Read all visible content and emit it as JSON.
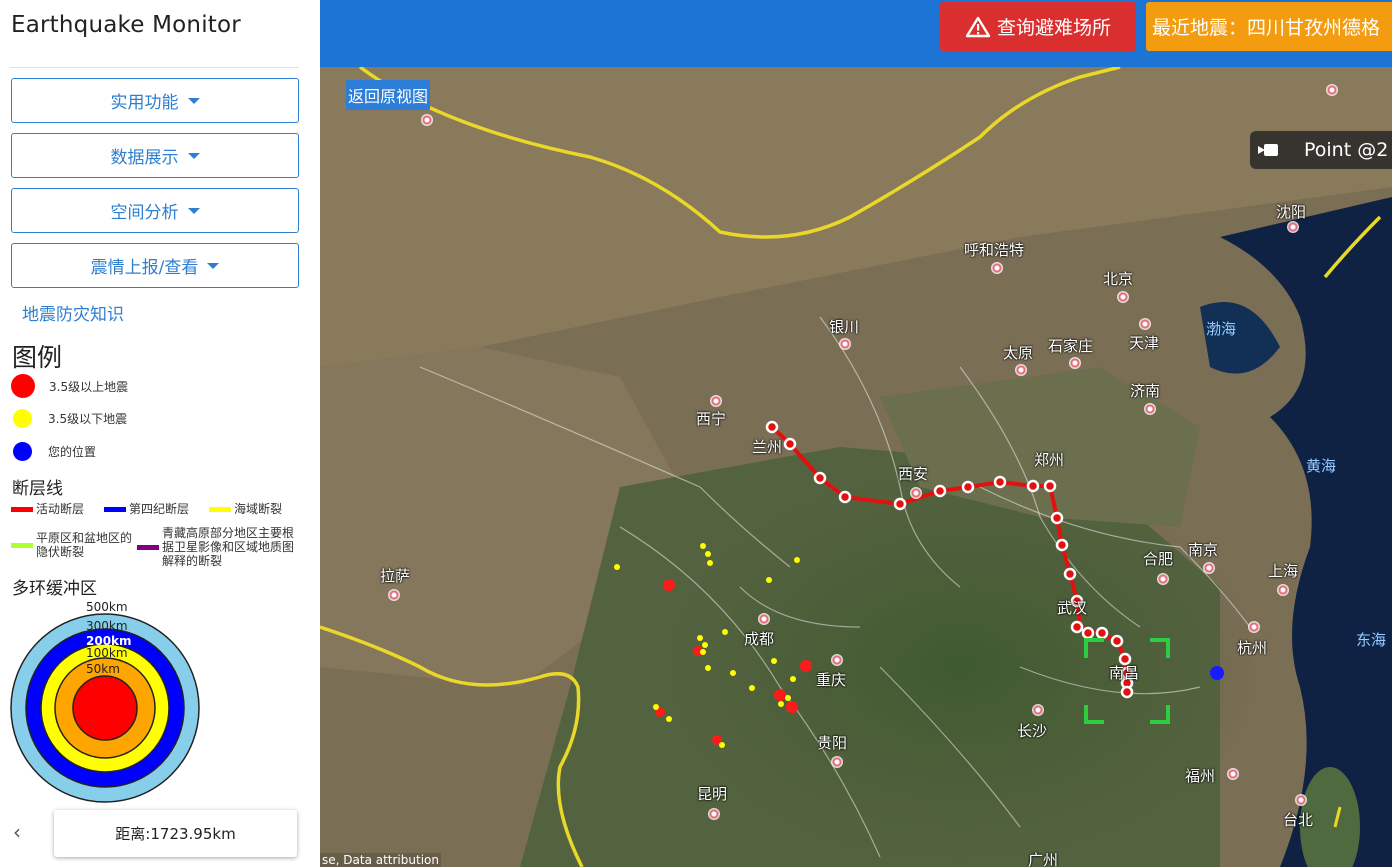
{
  "app": {
    "title": "Earthquake Monitor"
  },
  "menu": [
    {
      "label": "实用功能"
    },
    {
      "label": "数据展示"
    },
    {
      "label": "空间分析"
    },
    {
      "label": "震情上报/查看"
    }
  ],
  "knowledge_link": "地震防灾知识",
  "legend": {
    "title": "图例",
    "quake_items": [
      {
        "label": "3.5级以上地震",
        "color": "#ff0000"
      },
      {
        "label": "3.5级以下地震",
        "color": "#ffff00"
      },
      {
        "label": "您的位置",
        "color": "#0000ff"
      }
    ],
    "fault_title": "断层线",
    "fault_items": [
      {
        "label": "活动断层",
        "color": "#ff0000"
      },
      {
        "label": "第四纪断层",
        "color": "#0000ff"
      },
      {
        "label": "海域断裂",
        "color": "#ffff00"
      },
      {
        "label": "平原区和盆地区的隐伏断裂",
        "color": "#adff2f"
      },
      {
        "label": "青藏高原部分地区主要根据卫星影像和区域地质图解释的断裂",
        "color": "#800080"
      }
    ],
    "buffer_title": "多环缓冲区",
    "buffer_rings": [
      {
        "label": "500km",
        "color": "#87ceeb"
      },
      {
        "label": "300km",
        "color": "#0000ff"
      },
      {
        "label": "200km",
        "color": "#ffff00"
      },
      {
        "label": "100km",
        "color": "#ffa500"
      },
      {
        "label": "50km",
        "color": "#ff0000"
      }
    ]
  },
  "distance": {
    "label": "距离:1723.95km"
  },
  "topbar": {
    "shelter_button": "查询避难场所",
    "recent_quake": "最近地震：四川甘孜州德格"
  },
  "map": {
    "reset_button": "返回原视图",
    "point_tooltip": "Point @2",
    "attribution": "se, Data attribution",
    "cities": [
      {
        "name": "呼和浩特"
      },
      {
        "name": "北京"
      },
      {
        "name": "天津"
      },
      {
        "name": "银川"
      },
      {
        "name": "太原"
      },
      {
        "name": "石家庄"
      },
      {
        "name": "济南"
      },
      {
        "name": "西宁"
      },
      {
        "name": "兰州"
      },
      {
        "name": "西安"
      },
      {
        "name": "郑州"
      },
      {
        "name": "合肥"
      },
      {
        "name": "南京"
      },
      {
        "name": "上海"
      },
      {
        "name": "武汉"
      },
      {
        "name": "杭州"
      },
      {
        "name": "成都"
      },
      {
        "name": "重庆"
      },
      {
        "name": "南昌"
      },
      {
        "name": "长沙"
      },
      {
        "name": "拉萨"
      },
      {
        "name": "贵阳"
      },
      {
        "name": "昆明"
      },
      {
        "name": "福州"
      },
      {
        "name": "台北"
      },
      {
        "name": "沈阳"
      },
      {
        "name": "广州"
      }
    ],
    "seas": [
      {
        "name": "渤海"
      },
      {
        "name": "黄海"
      },
      {
        "name": "东海"
      }
    ]
  }
}
